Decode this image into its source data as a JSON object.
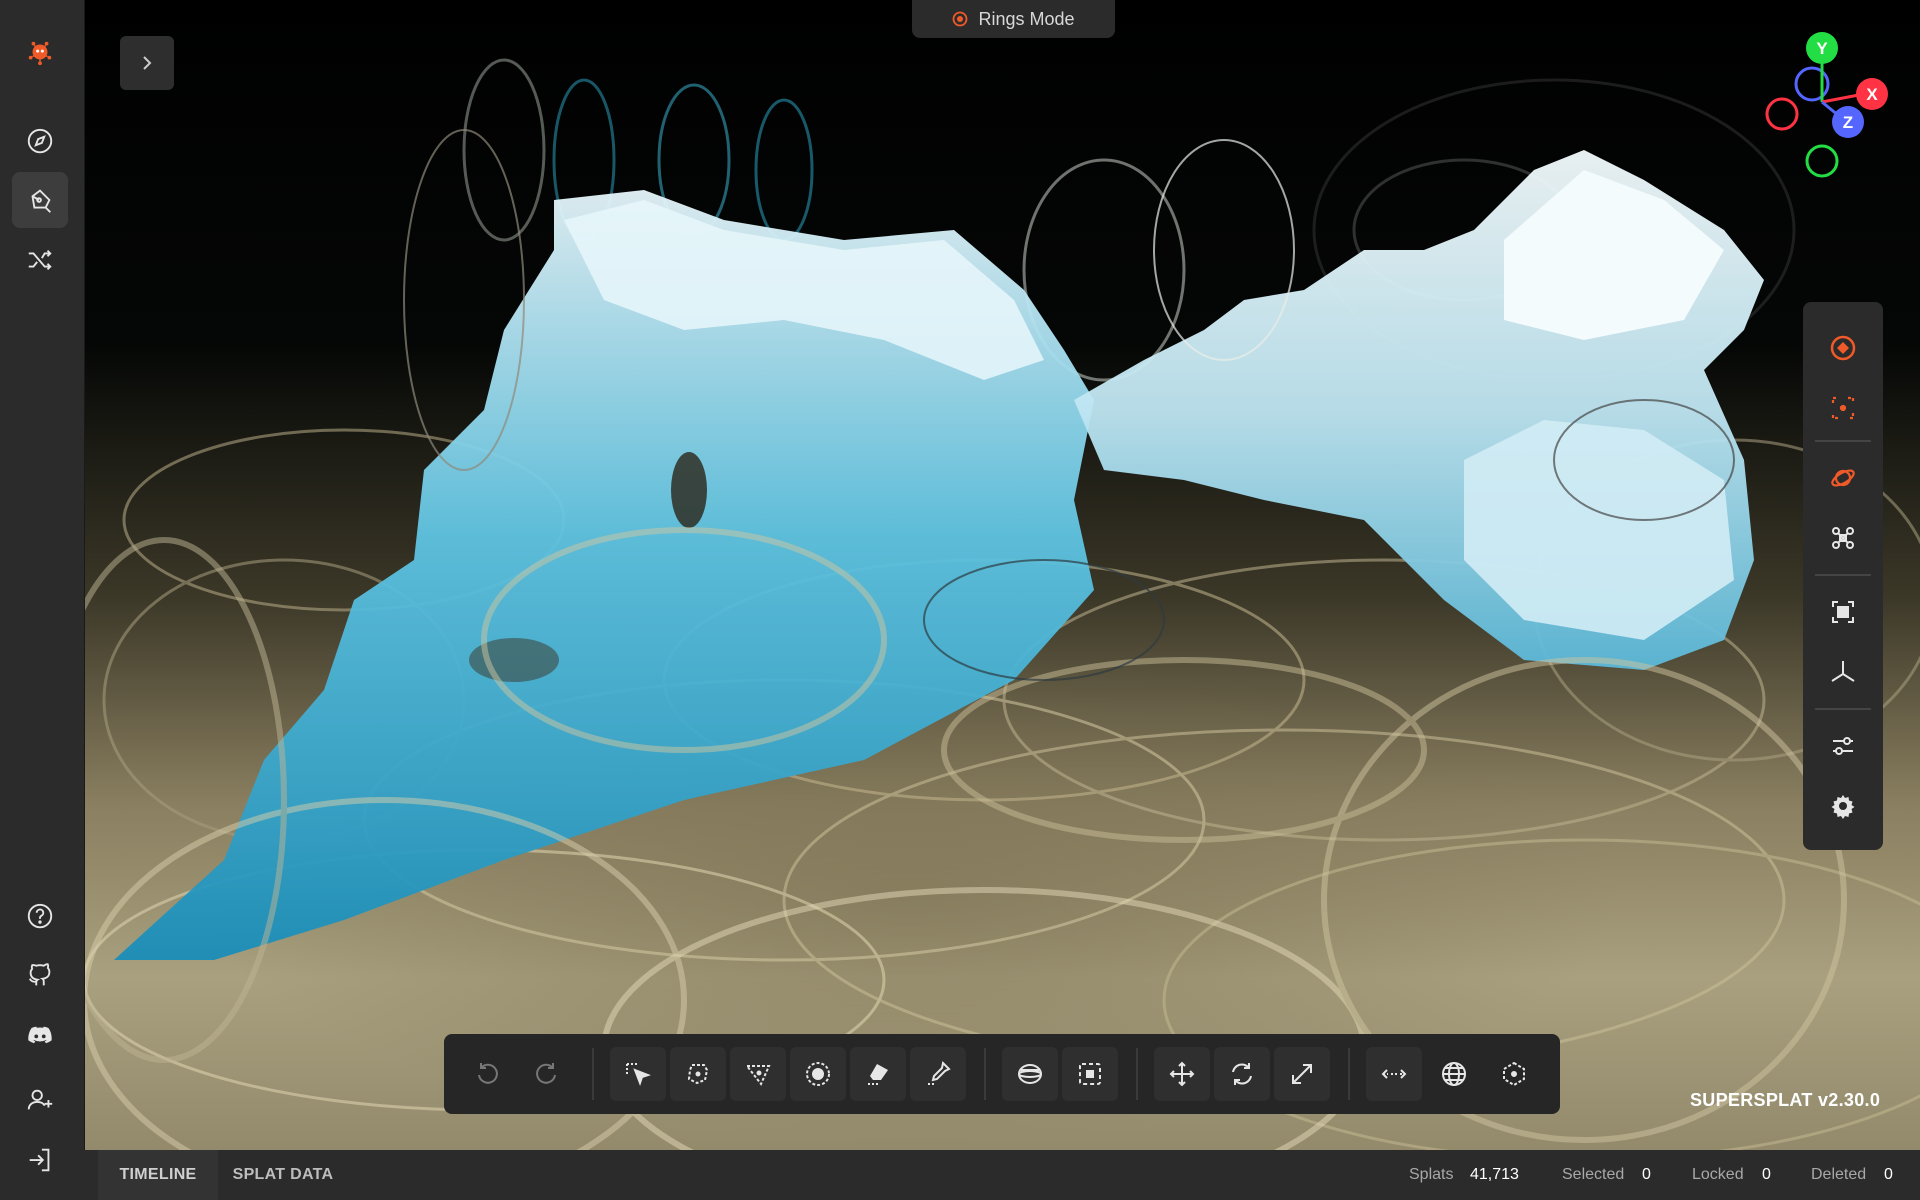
{
  "app": {
    "mode_label": "Rings Mode",
    "version": "SUPERSPLAT v2.30.0"
  },
  "sidebar": {
    "items": [
      {
        "name": "logo",
        "icon": "supersplat-logo-icon"
      },
      {
        "name": "explore",
        "icon": "compass-icon"
      },
      {
        "name": "edit",
        "icon": "pen-tool-icon",
        "active": true
      },
      {
        "name": "shuffle",
        "icon": "shuffle-icon"
      }
    ],
    "bottom_items": [
      {
        "name": "help",
        "icon": "help-circle-icon"
      },
      {
        "name": "github",
        "icon": "github-icon"
      },
      {
        "name": "discord",
        "icon": "discord-icon"
      },
      {
        "name": "add-user",
        "icon": "user-plus-icon"
      },
      {
        "name": "sign-in",
        "icon": "log-in-icon"
      }
    ]
  },
  "right_toolbar": {
    "items": [
      "rings-mode-icon",
      "centers-mode-icon",
      "orbit-camera-icon",
      "fly-camera-icon",
      "focus-frame-icon",
      "axes-icon",
      "view-options-icon",
      "settings-gear-icon"
    ]
  },
  "bottom_toolbar": {
    "items": [
      "undo-icon",
      "redo-icon",
      "picker-select-icon",
      "lasso-select-icon",
      "polygon-select-icon",
      "brush-select-icon",
      "eraser-select-icon",
      "eyedropper-select-icon",
      "sphere-select-icon",
      "box-select-icon",
      "move-icon",
      "rotate-icon",
      "scale-icon",
      "local-space-icon",
      "world-space-icon",
      "bound-center-icon"
    ]
  },
  "gizmo": {
    "x_label": "X",
    "y_label": "Y",
    "z_label": "Z",
    "x_color": "#ff3344",
    "y_color": "#22dd44",
    "z_color": "#5566ff"
  },
  "colors": {
    "accent": "#f05a28",
    "panel": "#2b2b2b"
  },
  "statusbar": {
    "tabs": [
      {
        "label": "TIMELINE",
        "active": true
      },
      {
        "label": "SPLAT DATA",
        "active": false
      }
    ],
    "stats": {
      "splats_label": "Splats",
      "splats_value": "41,713",
      "selected_label": "Selected",
      "selected_value": "0",
      "locked_label": "Locked",
      "locked_value": "0",
      "deleted_label": "Deleted",
      "deleted_value": "0"
    }
  }
}
